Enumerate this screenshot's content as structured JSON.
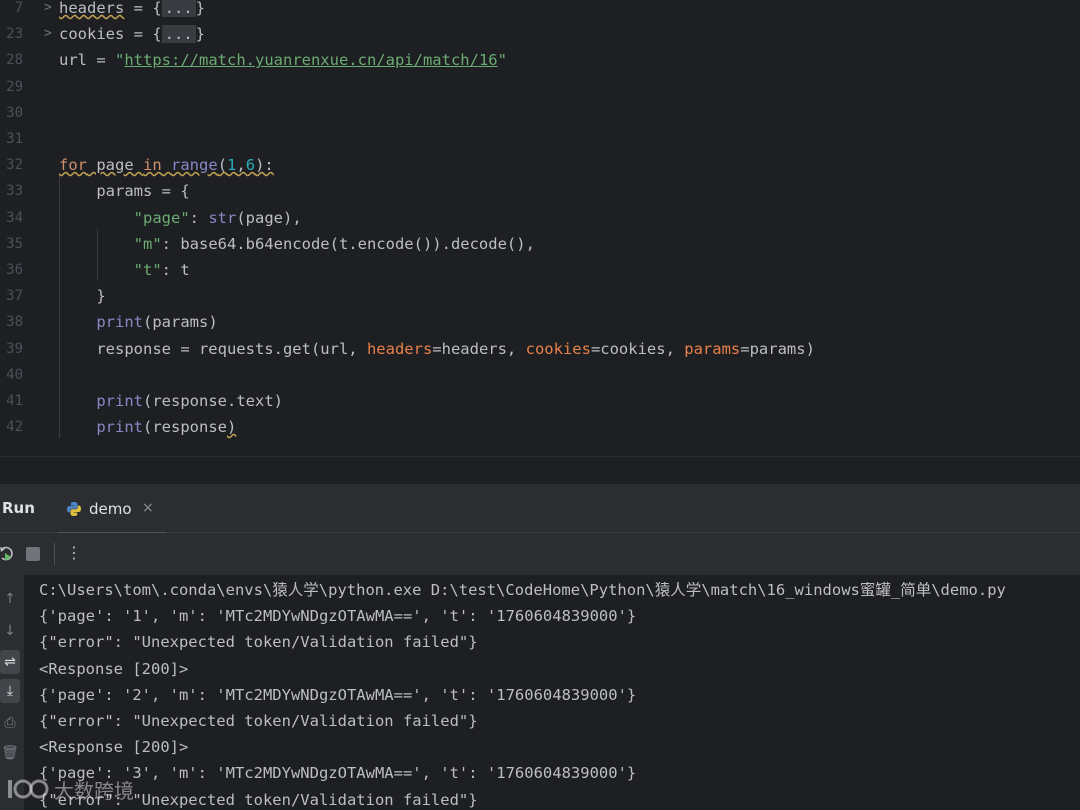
{
  "editor": {
    "lines": [
      {
        "n": "7",
        "html": "<span class='squiggle'>headers</span> = {<span class='fold-box'>...</span>}",
        "fold": true
      },
      {
        "n": "23",
        "html": "cookies = {<span class='fold-box'>...</span>}",
        "fold": true
      },
      {
        "n": "28",
        "html": "url = <span class='str'>\"</span><span class='link'>https://match.yuanrenxue.cn/api/match/16</span><span class='str'>\"</span>"
      },
      {
        "n": "29",
        "html": ""
      },
      {
        "n": "30",
        "html": ""
      },
      {
        "n": "31",
        "html": ""
      },
      {
        "n": "32",
        "html": "<span class='kw squiggle'>for</span><span class='squiggle'> page </span><span class='kw squiggle'>in</span><span class='squiggle'> </span><span class='builtin squiggle'>range</span><span class='squiggle'>(</span><span class='num squiggle'>1</span><span class='squiggle'>,</span><span class='num squiggle'>6</span><span class='squiggle'>):</span>"
      },
      {
        "n": "33",
        "html": "    params = {"
      },
      {
        "n": "34",
        "html": "        <span class='str'>\"page\"</span>: <span class='builtin'>str</span>(page),"
      },
      {
        "n": "35",
        "html": "        <span class='str'>\"m\"</span>: base64.b64encode(t.encode()).decode(),"
      },
      {
        "n": "36",
        "html": "        <span class='str'>\"t\"</span>: t"
      },
      {
        "n": "37",
        "html": "    }"
      },
      {
        "n": "38",
        "html": "    <span class='builtin'>print</span>(params)"
      },
      {
        "n": "39",
        "html": "    response = requests.get(url, <span class='param'>headers</span>=headers, <span class='param'>cookies</span>=cookies, <span class='param'>params</span>=params)"
      },
      {
        "n": "40",
        "html": ""
      },
      {
        "n": "41",
        "html": "    <span class='builtin'>print</span>(response.text)"
      },
      {
        "n": "42",
        "html": "    <span class='builtin'>print</span>(response<span class='squiggle'>)</span>"
      }
    ]
  },
  "run_panel": {
    "title": "Run",
    "tab_label": "demo",
    "tab_close": "×",
    "more": "⋮"
  },
  "console": {
    "lines": [
      "C:\\Users\\tom\\.conda\\envs\\猿人学\\python.exe D:\\test\\CodeHome\\Python\\猿人学\\match\\16_windows蜜罐_简单\\demo.py",
      "{'page': '1', 'm': 'MTc2MDYwNDgzOTAwMA==', 't': '1760604839000'}",
      "{\"error\": \"Unexpected token/Validation failed\"}",
      "<Response [200]>",
      "{'page': '2', 'm': 'MTc2MDYwNDgzOTAwMA==', 't': '1760604839000'}",
      "{\"error\": \"Unexpected token/Validation failed\"}",
      "<Response [200]>",
      "{'page': '3', 'm': 'MTc2MDYwNDgzOTAwMA==', 't': '1760604839000'}",
      "{\"error\": \"Unexpected token/Validation failed\"}"
    ]
  },
  "watermark": {
    "text": "大数跨境"
  },
  "icons": {
    "fold": "chevron-right-icon",
    "rerun": "rerun-icon",
    "stop": "stop-icon",
    "up": "arrow-up-icon",
    "down": "arrow-down-icon",
    "wrap": "soft-wrap-icon",
    "scroll": "scroll-to-end-icon",
    "print": "print-icon",
    "trash": "trash-icon"
  },
  "colors": {
    "background": "#1e1f22",
    "panel": "#2b2d30",
    "keyword": "#cf8e6d",
    "string": "#6aab73",
    "number": "#2aacb8",
    "builtin": "#8888c6",
    "named_param": "#e8804a"
  }
}
